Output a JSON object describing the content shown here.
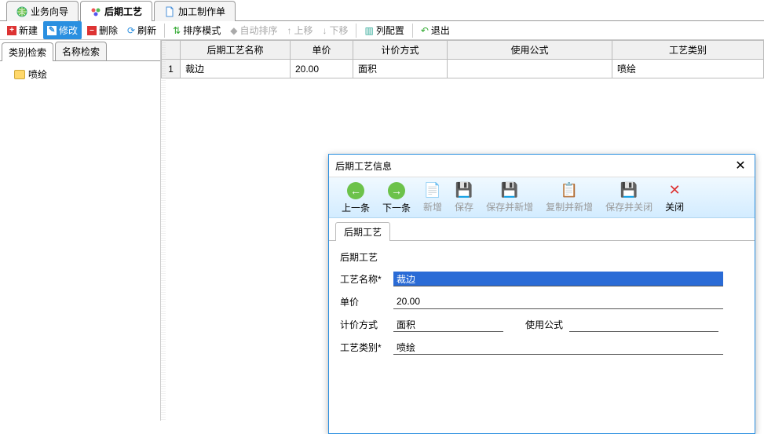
{
  "tabs": {
    "biz_guide": "业务向导",
    "post_process": "后期工艺",
    "prod_order": "加工制作单"
  },
  "toolbar": {
    "new": "新建",
    "edit": "修改",
    "delete": "删除",
    "refresh": "刷新",
    "sort_mode": "排序模式",
    "auto_sort": "自动排序",
    "move_up": "上移",
    "move_down": "下移",
    "col_config": "列配置",
    "exit": "退出"
  },
  "side_tabs": {
    "category_search": "类别检索",
    "name_search": "名称检索"
  },
  "tree": {
    "item1": "喷绘"
  },
  "grid": {
    "headers": {
      "name": "后期工艺名称",
      "price": "单价",
      "method": "计价方式",
      "formula": "使用公式",
      "category": "工艺类别"
    },
    "row1": {
      "num": "1",
      "name": "裁边",
      "price": "20.00",
      "method": "面积",
      "formula": "",
      "category": "喷绘"
    }
  },
  "dialog": {
    "title": "后期工艺信息",
    "toolbar": {
      "prev": "上一条",
      "next": "下一条",
      "add": "新增",
      "save": "保存",
      "save_add": "保存并新增",
      "copy_add": "复制并新增",
      "save_close": "保存并关闭",
      "close": "关闭"
    },
    "tab": "后期工艺",
    "section": "后期工艺",
    "labels": {
      "name": "工艺名称*",
      "price": "单价",
      "method": "计价方式",
      "formula": "使用公式",
      "category": "工艺类别*"
    },
    "values": {
      "name": "裁边",
      "price": "20.00",
      "method": "面积",
      "formula": "",
      "category": "喷绘"
    }
  }
}
